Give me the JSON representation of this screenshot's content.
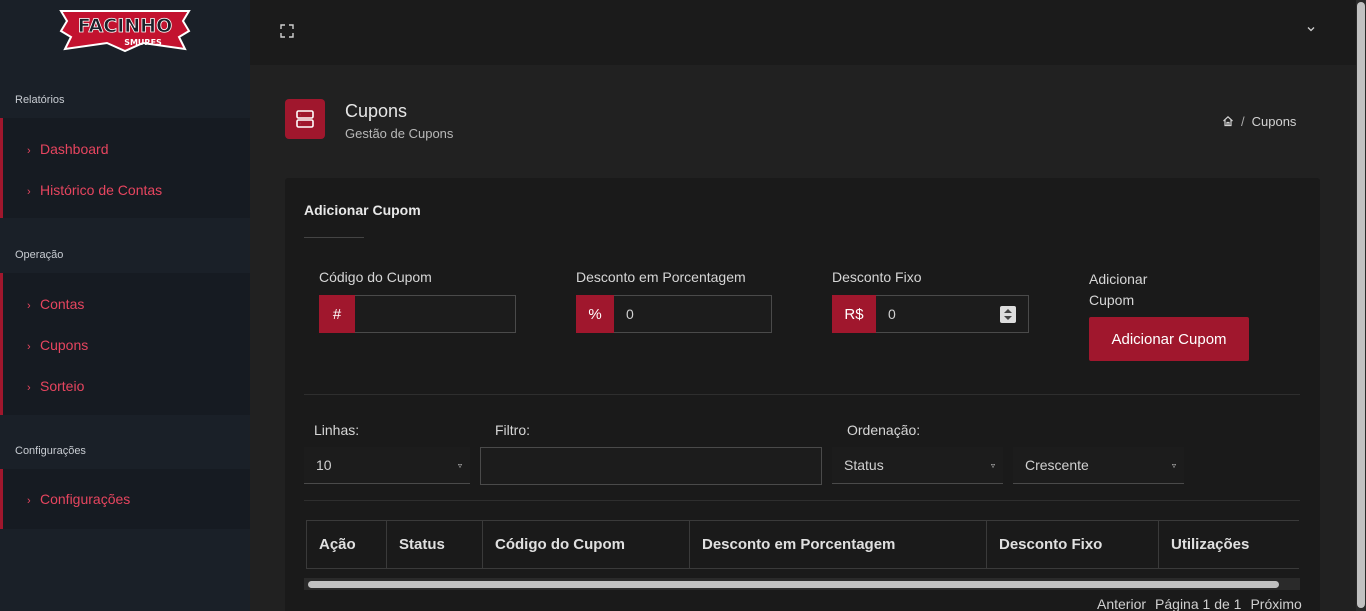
{
  "sidebar": {
    "logo_text": "FACINHO SMURFS",
    "sections": [
      {
        "title": "Relatórios",
        "items": [
          "Dashboard",
          "Histórico de Contas"
        ]
      },
      {
        "title": "Operação",
        "items": [
          "Contas",
          "Cupons",
          "Sorteio"
        ]
      },
      {
        "title": "Configurações",
        "items": [
          "Configurações"
        ]
      }
    ]
  },
  "page": {
    "title": "Cupons",
    "subtitle": "Gestão de Cupons",
    "breadcrumb_current": "Cupons",
    "breadcrumb_sep": "/"
  },
  "form": {
    "title": "Adicionar Cupom",
    "code_label": "Código do Cupom",
    "code_addon": "#",
    "code_value": "",
    "pct_label": "Desconto em Porcentagem",
    "pct_addon": "%",
    "pct_value": "0",
    "fixed_label": "Desconto Fixo",
    "fixed_addon": "R$",
    "fixed_value": "0",
    "add_label_line1": "Adicionar",
    "add_label_line2": "Cupom",
    "add_button": "Adicionar Cupom"
  },
  "controls": {
    "rows_label": "Linhas:",
    "rows_value": "10",
    "filter_label": "Filtro:",
    "sort_label": "Ordenação:",
    "sort_field": "Status",
    "sort_dir": "Crescente"
  },
  "table": {
    "columns": [
      "Ação",
      "Status",
      "Código do Cupom",
      "Desconto em Porcentagem",
      "Desconto Fixo",
      "Utilizações"
    ]
  },
  "pager": {
    "prev": "Anterior",
    "page_info": "Página 1 de 1",
    "next": "Próximo"
  },
  "colors": {
    "accent": "#a0172d",
    "link": "#e6455f"
  }
}
